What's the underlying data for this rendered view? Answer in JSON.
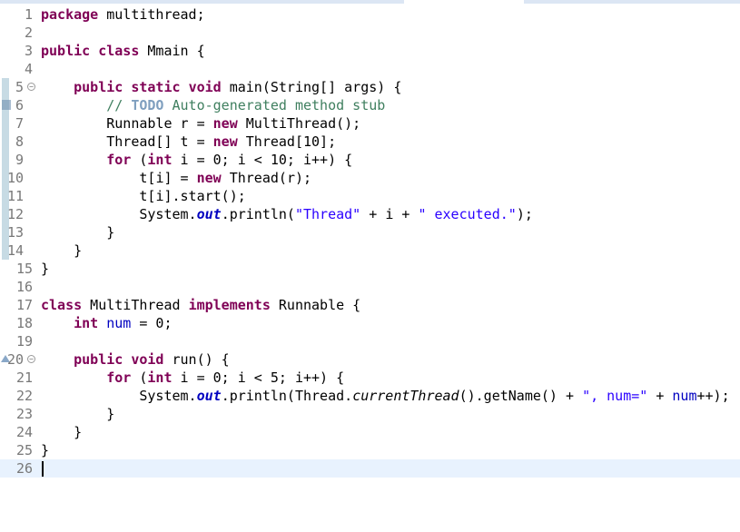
{
  "editor": {
    "lines": [
      {
        "n": "1",
        "tokens": [
          [
            "kw",
            "package"
          ],
          [
            "",
            "multithread;"
          ]
        ],
        "text": ""
      },
      {
        "n": "2",
        "tokens": []
      },
      {
        "n": "3",
        "tokens": [
          [
            "kw",
            "public"
          ],
          [
            "",
            ""
          ],
          [
            "kw",
            "class"
          ],
          [
            "",
            "Mmain {"
          ]
        ]
      },
      {
        "n": "4",
        "tokens": []
      },
      {
        "n": "5",
        "tokens": []
      },
      {
        "n": "6",
        "tokens": []
      },
      {
        "n": "7",
        "tokens": []
      },
      {
        "n": "8",
        "tokens": []
      },
      {
        "n": "9",
        "tokens": []
      },
      {
        "n": "10",
        "tokens": []
      },
      {
        "n": "11",
        "tokens": []
      },
      {
        "n": "12",
        "tokens": []
      },
      {
        "n": "13",
        "tokens": []
      },
      {
        "n": "14",
        "tokens": []
      },
      {
        "n": "15",
        "tokens": []
      },
      {
        "n": "16",
        "tokens": []
      },
      {
        "n": "17",
        "tokens": []
      },
      {
        "n": "18",
        "tokens": []
      },
      {
        "n": "19",
        "tokens": []
      },
      {
        "n": "20",
        "tokens": []
      },
      {
        "n": "21",
        "tokens": []
      },
      {
        "n": "22",
        "tokens": []
      },
      {
        "n": "23",
        "tokens": []
      },
      {
        "n": "24",
        "tokens": []
      },
      {
        "n": "25",
        "tokens": []
      },
      {
        "n": "26",
        "tokens": []
      }
    ],
    "code": {
      "l1_kw": "package",
      "l1_rest": " multithread;",
      "l3_kw1": "public",
      "l3_kw2": "class",
      "l3_rest": " Mmain {",
      "l5_kw1": "public",
      "l5_kw2": "static",
      "l5_kw3": "void",
      "l5_rest1": " main(String[] ",
      "l5_param": "args",
      "l5_rest2": ") {",
      "l6_c1": "// ",
      "l6_todo": "TODO",
      "l6_c2": " Auto-generated method stub",
      "l7_a": "Runnable ",
      "l7_var": "r",
      "l7_b": " = ",
      "l7_kw": "new",
      "l7_c": " MultiThread();",
      "l8_a": "Thread[] ",
      "l8_var": "t",
      "l8_b": " = ",
      "l8_kw": "new",
      "l8_c": " Thread[10];",
      "l9_kw1": "for",
      "l9_a": " (",
      "l9_kw2": "int",
      "l9_sp": " ",
      "l9_v1": "i",
      "l9_b": " = 0; ",
      "l9_v2": "i",
      "l9_c": " < 10; ",
      "l9_v3": "i",
      "l9_d": "++) {",
      "l10_v1": "t",
      "l10_a": "[",
      "l10_v2": "i",
      "l10_b": "] = ",
      "l10_kw": "new",
      "l10_c": " Thread(",
      "l10_v3": "r",
      "l10_d": ");",
      "l11_v1": "t",
      "l11_a": "[",
      "l11_v2": "i",
      "l11_b": "].start();",
      "l12_a": "System.",
      "l12_out": "out",
      "l12_b": ".println(",
      "l12_s1": "\"Thread\"",
      "l12_c": " + ",
      "l12_v": "i",
      "l12_d": " + ",
      "l12_s2": "\" executed.\"",
      "l12_e": ");",
      "l13": "}",
      "l14": "}",
      "l15": "}",
      "l17_kw1": "class",
      "l17_a": " MultiThread ",
      "l17_kw2": "implements",
      "l17_b": " Runnable {",
      "l18_kw": "int",
      "l18_sp": " ",
      "l18_fld": "num",
      "l18_a": " = 0;",
      "l20_kw1": "public",
      "l20_kw2": "void",
      "l20_a": " run() {",
      "l21_kw1": "for",
      "l21_a": " (",
      "l21_kw2": "int",
      "l21_sp": " ",
      "l21_v1": "i",
      "l21_b": " = 0; ",
      "l21_v2": "i",
      "l21_c": " < 5; ",
      "l21_v3": "i",
      "l21_d": "++) {",
      "l22_a": "System.",
      "l22_out": "out",
      "l22_b": ".println(Thread.",
      "l22_meth": "currentThread",
      "l22_c": "().getName() + ",
      "l22_s": "\", num=\"",
      "l22_d": " + ",
      "l22_fld": "num",
      "l22_e": "++);",
      "l23": "}",
      "l24": "}",
      "l25": "}"
    },
    "colors": {
      "keyword": "#7f0055",
      "comment": "#3f7f5f",
      "todo": "#7f9fbf",
      "string": "#2a00ff",
      "field": "#0000c0",
      "line_number": "#787878",
      "current_line": "#e8f2fe"
    }
  }
}
